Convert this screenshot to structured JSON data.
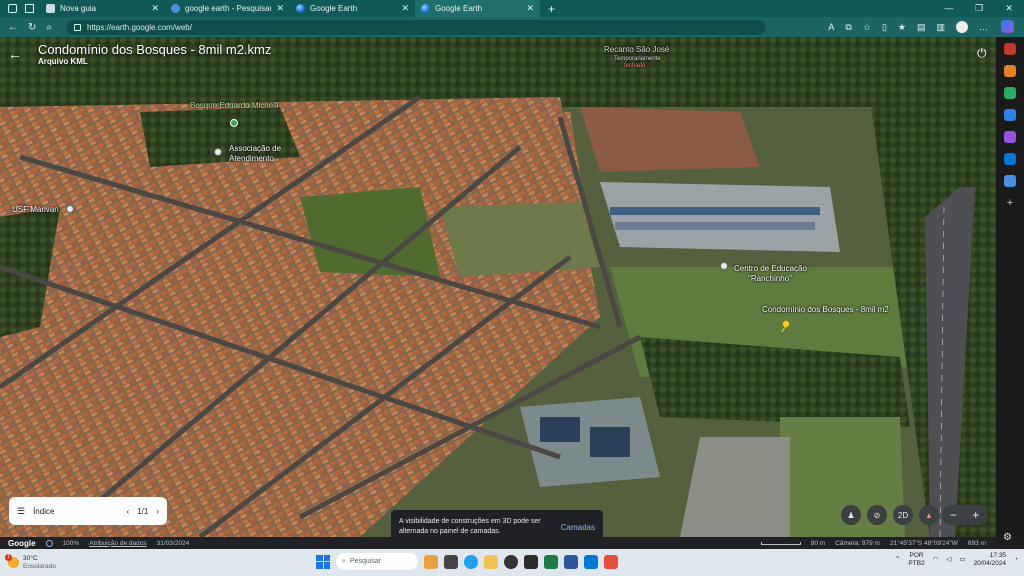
{
  "browser": {
    "tabs": [
      {
        "label": "Nova guia",
        "icon": "page-icon",
        "active": false
      },
      {
        "label": "google earth - Pesquisar",
        "icon": "search-results-icon",
        "active": false
      },
      {
        "label": "Google Earth",
        "icon": "google-earth-icon",
        "active": false
      },
      {
        "label": "Google Earth",
        "icon": "google-earth-icon",
        "active": true
      }
    ],
    "url": "https://earth.google.com/web/"
  },
  "earth": {
    "title": "Condomínio dos Bosques - 8mil m2.kmz",
    "subtitle": "Arquivo KML",
    "labels": {
      "bosque": "Bosque Eduardo Michelli",
      "associacao_line1": "Associação de",
      "associacao_line2": "Atendimento",
      "usf": "USF Marivan",
      "recanto": "Recanto São José",
      "recanto_sub1": "Temporariamente",
      "recanto_sub2": "fechado",
      "centro_line1": "Centro de Educação",
      "centro_line2": "\"Ranchinho\"",
      "condominio": "Condomínio dos Bosques - 8mil m2"
    },
    "index_panel": {
      "label": "Índice",
      "page": "1/1"
    },
    "toast": {
      "message": "A visibilidade de construções em 3D pode ser alternada no painel de camadas.",
      "action": "Camadas"
    },
    "controls": {
      "mode_2d": "2D"
    },
    "status": {
      "brand": "Google",
      "progress": "100%",
      "attribution": "Atribuição de dados",
      "date": "31/03/2024",
      "scale": "80 m",
      "camera": "Câmera: 979 m",
      "coords": "21°45'37\"S 48°09'24\"W",
      "elevation": "693 m"
    }
  },
  "taskbar": {
    "weather_temp": "30°C",
    "weather_desc": "Ensolarado",
    "weather_badge": "1",
    "search_placeholder": "Pesquisar",
    "lang_line1": "POR",
    "lang_line2": "PTB2",
    "time": "17:35",
    "date": "20/04/2024"
  },
  "colors": {
    "tabstrip": "#0f5a57",
    "addressbar": "#1b6662",
    "accent": "#8ab4f8",
    "pushpin": "#f6d21e"
  }
}
